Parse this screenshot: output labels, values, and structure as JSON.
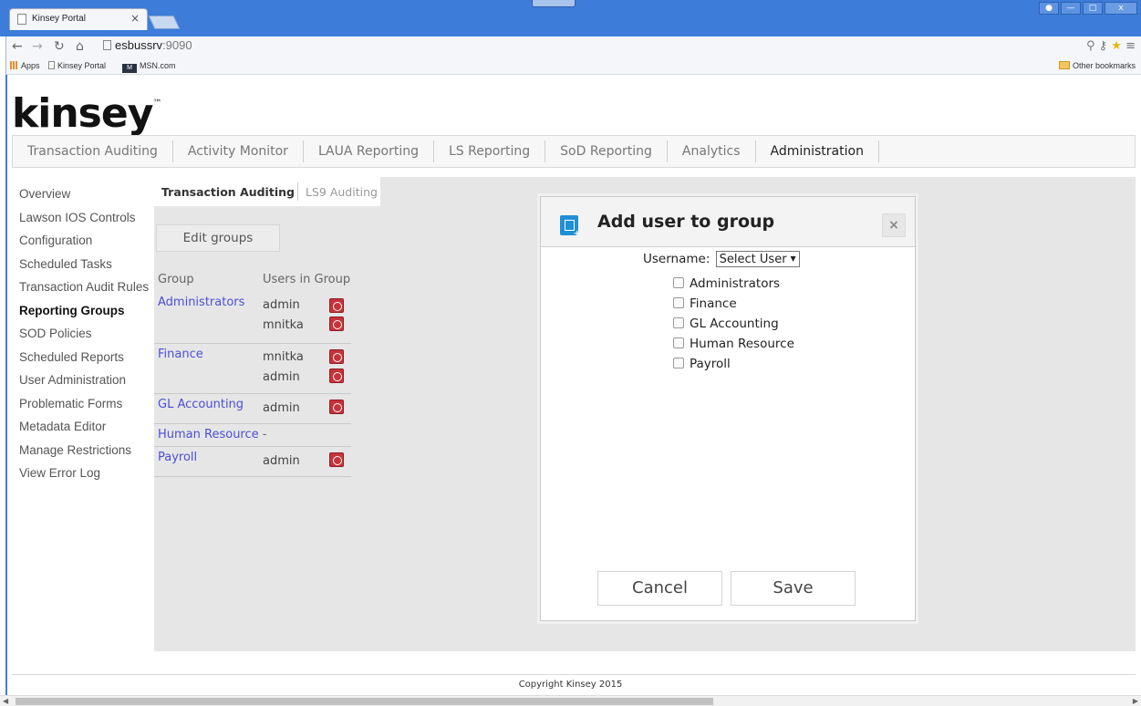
{
  "browser": {
    "tab_title": "Kinsey Portal",
    "tab_close": "×",
    "url_host": "esbussrv",
    "url_port": ":9090",
    "bookmarks": [
      {
        "label": "Apps",
        "icon": "apps-grid-icon"
      },
      {
        "label": "Kinsey Portal",
        "icon": "page-icon"
      },
      {
        "label": "MSN.com",
        "icon": "msn-icon"
      }
    ],
    "other_bookmarks": "Other bookmarks",
    "window_controls": [
      "person",
      "—",
      "□",
      "x"
    ]
  },
  "logo": {
    "text": "kinsey",
    "mark": "™"
  },
  "main_tabs": [
    {
      "label": "Transaction Auditing",
      "active": false
    },
    {
      "label": "Activity Monitor",
      "active": false
    },
    {
      "label": "LAUA Reporting",
      "active": false
    },
    {
      "label": "LS Reporting",
      "active": false
    },
    {
      "label": "SoD Reporting",
      "active": false
    },
    {
      "label": "Analytics",
      "active": false
    },
    {
      "label": "Administration",
      "active": true
    }
  ],
  "sidebar": [
    {
      "label": "Overview"
    },
    {
      "label": "Lawson IOS Controls"
    },
    {
      "label": "Configuration"
    },
    {
      "label": "Scheduled Tasks"
    },
    {
      "label": "Transaction Audit Rules"
    },
    {
      "label": "Reporting Groups",
      "active": true
    },
    {
      "label": "SOD Policies"
    },
    {
      "label": "Scheduled Reports"
    },
    {
      "label": "User Administration"
    },
    {
      "label": "Problematic Forms"
    },
    {
      "label": "Metadata Editor"
    },
    {
      "label": "Manage Restrictions"
    },
    {
      "label": "View Error Log"
    }
  ],
  "sub_tabs": {
    "active": "Transaction Auditing",
    "other": "LS9 Auditing"
  },
  "edit_groups_label": "Edit groups",
  "groups_table": {
    "headers": {
      "group": "Group",
      "users": "Users in Group"
    },
    "groups": [
      {
        "name": "Administrators",
        "users": [
          "admin",
          "mnitka"
        ]
      },
      {
        "name": "Finance",
        "users": [
          "mnitka",
          "admin"
        ]
      },
      {
        "name": "GL Accounting",
        "users": [
          "admin"
        ]
      },
      {
        "name": "Human Resource",
        "users": [],
        "empty": "-"
      },
      {
        "name": "Payroll",
        "users": [
          "admin"
        ]
      }
    ]
  },
  "modal": {
    "title": "Add user to group",
    "close": "×",
    "username_label": "Username:",
    "username_select": "Select User",
    "groups": [
      "Administrators",
      "Finance",
      "GL Accounting",
      "Human Resource",
      "Payroll"
    ],
    "cancel": "Cancel",
    "save": "Save"
  },
  "footer": "Copyright Kinsey 2015"
}
